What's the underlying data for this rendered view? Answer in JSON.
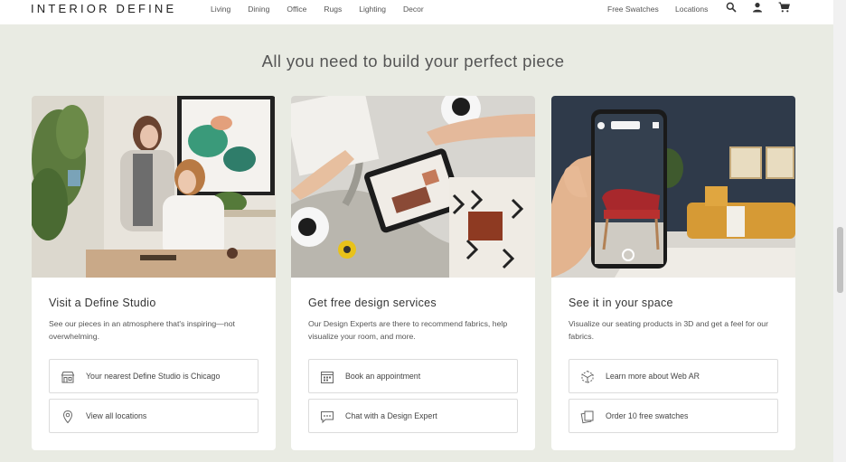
{
  "header": {
    "logo": "INTERIOR DEFINE",
    "nav": [
      "Living",
      "Dining",
      "Office",
      "Rugs",
      "Lighting",
      "Decor"
    ],
    "free_swatches": "Free Swatches",
    "locations": "Locations",
    "icons": [
      "search-icon",
      "account-icon",
      "cart-icon"
    ]
  },
  "section": {
    "title": "All you need to build your perfect piece"
  },
  "cards": [
    {
      "title": "Visit a Define Studio",
      "description": "See our pieces in an atmosphere that's inspiring—not overwhelming.",
      "ctas": [
        {
          "label": "Your nearest Define Studio is Chicago",
          "icon": "storefront-icon"
        },
        {
          "label": "View all locations",
          "icon": "location-pin-icon"
        }
      ]
    },
    {
      "title": "Get free design services",
      "description": "Our Design Experts are there to recommend fabrics, help visualize your room, and more.",
      "ctas": [
        {
          "label": "Book an appointment",
          "icon": "calendar-icon"
        },
        {
          "label": "Chat with a Design Expert",
          "icon": "chat-icon"
        }
      ]
    },
    {
      "title": "See it in your space",
      "description": "Visualize our seating products in 3D and get a feel for our fabrics.",
      "ctas": [
        {
          "label": "Learn more about Web AR",
          "icon": "ar-cube-icon"
        },
        {
          "label": "Order 10 free swatches",
          "icon": "swatch-icon"
        }
      ]
    }
  ],
  "colors": {
    "page_bg": "#e9ebe3",
    "card_bg": "#ffffff",
    "header_bg": "#ffffff"
  }
}
